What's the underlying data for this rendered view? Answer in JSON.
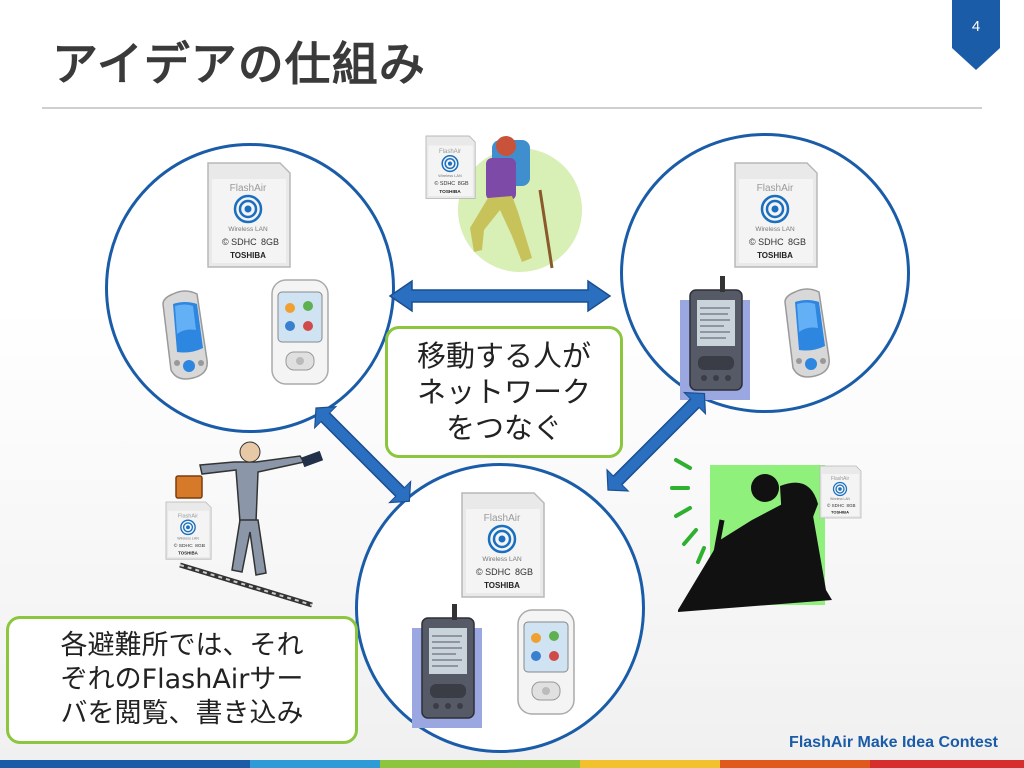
{
  "title": "アイデアの仕組み",
  "page_number": "4",
  "center_callout": {
    "lines": [
      "移動する人が",
      "ネットワーク",
      "をつなぐ"
    ]
  },
  "bottom_callout": {
    "lines": [
      "各避難所では、それ",
      "ぞれのFlashAirサー",
      "バを閲覧、書き込み"
    ]
  },
  "footer": {
    "text": "FlashAir Make Idea Contest"
  },
  "sd_card": {
    "brand": "FlashAir",
    "feature": "Wireless LAN",
    "capacity": "8GB",
    "maker": "TOSHIBA"
  },
  "colors": {
    "accent_blue": "#1a5ca8",
    "callout_border": "#8cc63f",
    "footer_bar": [
      "#1a5ca8",
      "#1a5ca8",
      "#2e9ad6",
      "#8cc63f",
      "#f2c12e",
      "#e05a1e",
      "#d62d2d"
    ]
  },
  "icons": [
    "sd-card-icon",
    "mobile-phone-icon",
    "smartphone-icon",
    "pda-icon",
    "hiker-icon",
    "businessman-icon",
    "climber-silhouette-icon",
    "double-arrow-icon"
  ]
}
